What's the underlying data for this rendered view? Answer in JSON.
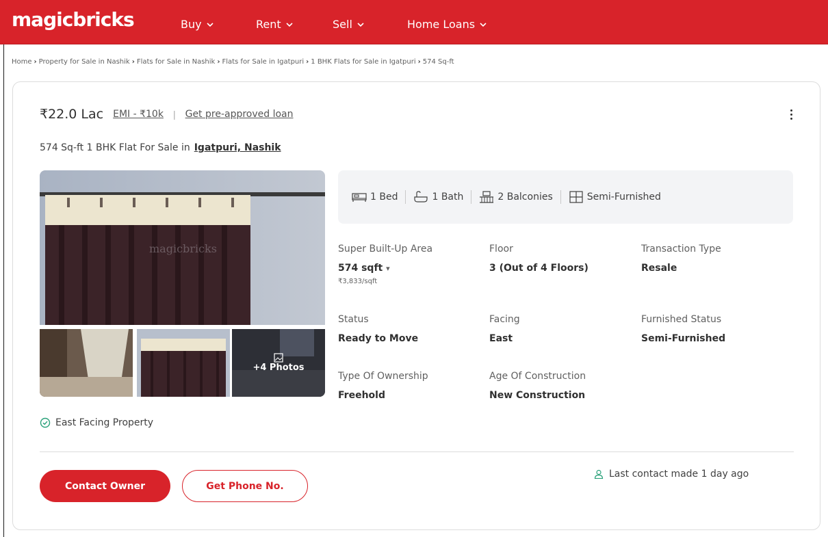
{
  "header": {
    "logo": "magicbricks",
    "nav": [
      {
        "label": "Buy"
      },
      {
        "label": "Rent"
      },
      {
        "label": "Sell"
      },
      {
        "label": "Home Loans"
      }
    ]
  },
  "breadcrumb": [
    "Home",
    "Property for Sale in Nashik",
    "Flats for Sale in Nashik",
    "Flats for Sale in Igatpuri",
    "1 BHK Flats for Sale in Igatpuri",
    "574 Sq-ft"
  ],
  "listing": {
    "price": "₹22.0 Lac",
    "emi": "EMI - ₹10k",
    "preapproved": "Get pre-approved loan",
    "title": "574 Sq-ft 1 BHK Flat For Sale in",
    "location": "Igatpuri, Nashik",
    "watermark": "magicbricks",
    "more_photos": "+4 Photos",
    "amenities": [
      {
        "icon": "bed-icon",
        "label": "1 Bed"
      },
      {
        "icon": "bath-icon",
        "label": "1 Bath"
      },
      {
        "icon": "balcony-icon",
        "label": "2 Balconies"
      },
      {
        "icon": "furnish-icon",
        "label": "Semi-Furnished"
      }
    ],
    "details": {
      "area_label": "Super Built-Up Area",
      "area_value": "574 sqft",
      "area_rate": "₹3,833/sqft",
      "floor_label": "Floor",
      "floor_value": "3 (Out of 4 Floors)",
      "transaction_label": "Transaction Type",
      "transaction_value": "Resale",
      "status_label": "Status",
      "status_value": "Ready to Move",
      "facing_label": "Facing",
      "facing_value": "East",
      "furnished_label": "Furnished Status",
      "furnished_value": "Semi-Furnished",
      "ownership_label": "Type Of Ownership",
      "ownership_value": "Freehold",
      "age_label": "Age Of Construction",
      "age_value": "New Construction"
    },
    "feature": "East Facing Property",
    "contact_owner": "Contact Owner",
    "get_phone": "Get Phone No.",
    "last_contact": "Last contact made 1 day ago"
  },
  "colors": {
    "brand": "#d8232a",
    "feature_green": "#2aa17a"
  }
}
